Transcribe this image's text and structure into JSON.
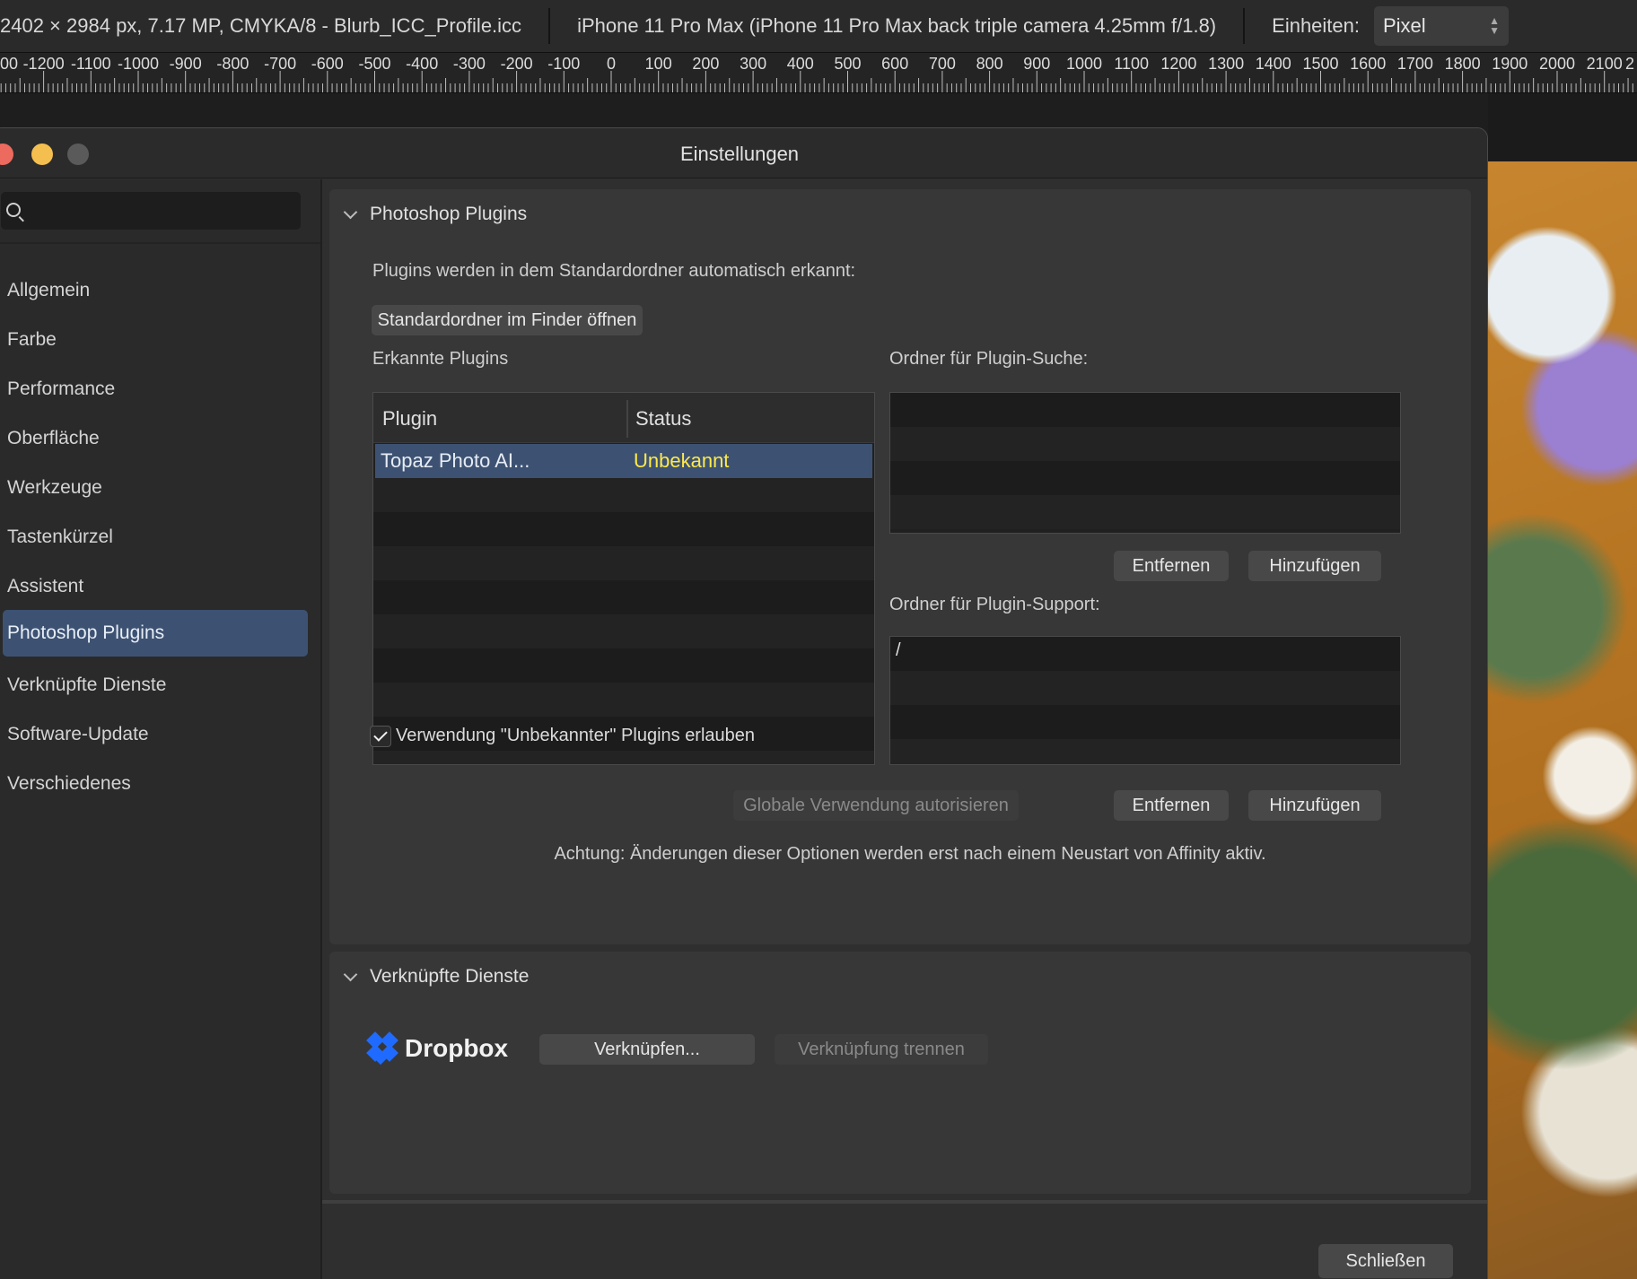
{
  "toolbar": {
    "doc_info": "2402 × 2984 px, 7.17 MP, CMYKA/8 - Blurb_ICC_Profile.icc",
    "camera_info": "iPhone 11 Pro Max (iPhone 11 Pro Max back triple camera 4.25mm f/1.8)",
    "units_label": "Einheiten:",
    "units_value": "Pixel"
  },
  "ruler": {
    "labels": [
      "00",
      "-1200",
      "-1100",
      "-1000",
      "-900",
      "-800",
      "-700",
      "-600",
      "-500",
      "-400",
      "-300",
      "-200",
      "-100",
      "0",
      "100",
      "200",
      "300",
      "400",
      "500",
      "600",
      "700",
      "800",
      "900",
      "1000",
      "1100",
      "1200",
      "1300",
      "1400",
      "1500",
      "1600",
      "1700",
      "1800",
      "1900",
      "2000",
      "2100",
      "2"
    ]
  },
  "dialog": {
    "title": "Einstellungen",
    "search_placeholder": ""
  },
  "sidebar": {
    "items": [
      {
        "label": "Allgemein"
      },
      {
        "label": "Farbe"
      },
      {
        "label": "Performance"
      },
      {
        "label": "Oberfläche"
      },
      {
        "label": "Werkzeuge"
      },
      {
        "label": "Tastenkürzel"
      },
      {
        "label": "Assistent"
      },
      {
        "label": "Photoshop Plugins"
      },
      {
        "label": "Verknüpfte Dienste"
      },
      {
        "label": "Software-Update"
      },
      {
        "label": "Verschiedenes"
      }
    ]
  },
  "plugins_panel": {
    "heading": "Photoshop Plugins",
    "auto_detect_text": "Plugins werden in dem Standardordner automatisch erkannt:",
    "open_folder_button": "Standardordner im Finder öffnen",
    "detected_label": "Erkannte Plugins",
    "table": {
      "col_plugin": "Plugin",
      "col_status": "Status",
      "rows": [
        {
          "plugin": "Topaz Photo AI...",
          "status": "Unbekannt"
        }
      ]
    },
    "search_folder_label": "Ordner für Plugin-Suche:",
    "support_folder_label": "Ordner für Plugin-Support:",
    "support_folder_value": "/",
    "remove_button": "Entfernen",
    "add_button": "Hinzufügen",
    "allow_unknown_label": "Verwendung \"Unbekannter\" Plugins erlauben",
    "allow_unknown_checked": true,
    "global_authorize_button": "Globale Verwendung autorisieren",
    "restart_note": "Achtung: Änderungen dieser Optionen werden erst nach einem Neustart von Affinity aktiv."
  },
  "services_panel": {
    "heading": "Verknüpfte Dienste",
    "service_name": "Dropbox",
    "link_button": "Verknüpfen...",
    "unlink_button": "Verknüpfung trennen"
  },
  "footer": {
    "close_button": "Schließen"
  },
  "colors": {
    "selection": "#3d5272",
    "status_unknown": "#ffe94a",
    "dropbox_blue": "#1f6bff"
  }
}
